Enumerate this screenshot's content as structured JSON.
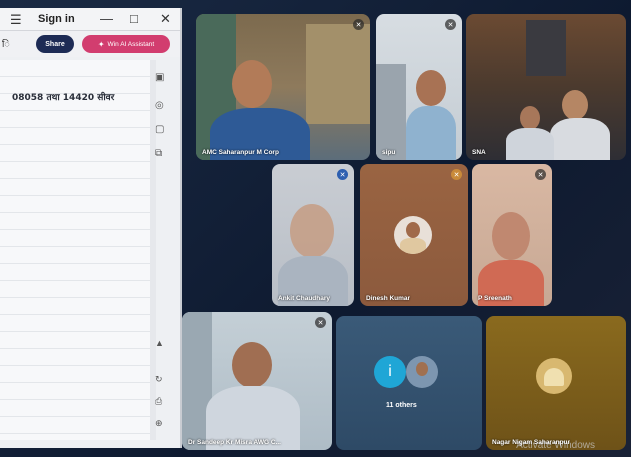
{
  "doc_window": {
    "title": "Sign in",
    "menu_icon": "menu-icon",
    "minimize": "—",
    "maximize": "□",
    "close": "✕",
    "share_label": "Share",
    "ai_label": "Win AI Assistant",
    "left_glyph": "ि",
    "body_text": "08058 तथा 14420 सीवर"
  },
  "participants": [
    {
      "name": "AMC Saharanpur M Corp"
    },
    {
      "name": "sipu"
    },
    {
      "name": "SNA"
    },
    {
      "name": "Ankit Chaudhary"
    },
    {
      "name": "Dinesh Kumar"
    },
    {
      "name": "P Sreenath"
    },
    {
      "name": "Dr Sandeep Kr Misra AWG C..."
    },
    {
      "name": "11 others"
    },
    {
      "name": "Nagar Nigam Saharanpur"
    }
  ],
  "watermark": "Activate Windows",
  "colors": {
    "share": "#1d2b55",
    "ai": "#d23d6f",
    "page": "#0e1a30"
  }
}
